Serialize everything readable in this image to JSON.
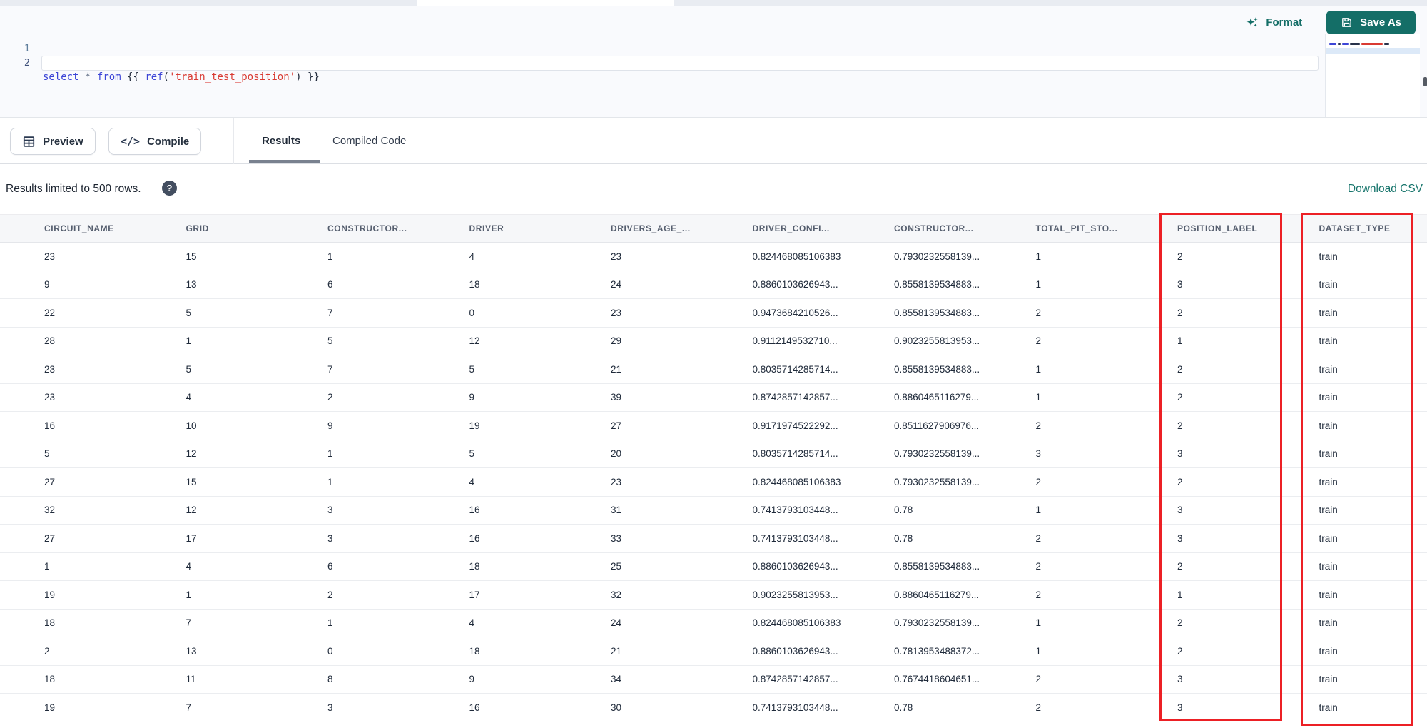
{
  "editor": {
    "line_numbers": [
      "1",
      "2"
    ],
    "code_line": {
      "tokens": [
        {
          "text": "select",
          "color": "#3c45d6"
        },
        {
          "text": " ",
          "color": "#222b3c"
        },
        {
          "text": "*",
          "color": "#5a6880"
        },
        {
          "text": " ",
          "color": "#222b3c"
        },
        {
          "text": "from",
          "color": "#3c45d6"
        },
        {
          "text": " {{ ",
          "color": "#222b3c"
        },
        {
          "text": "ref",
          "color": "#3c45d6"
        },
        {
          "text": "(",
          "color": "#222b3c"
        },
        {
          "text": "'train_test_position'",
          "color": "#d93a32"
        },
        {
          "text": ")",
          "color": "#222b3c"
        },
        {
          "text": " }}",
          "color": "#222b3c"
        }
      ]
    },
    "format_label": "Format",
    "save_as_label": "Save As"
  },
  "toolbar": {
    "preview_label": "Preview",
    "compile_label": "Compile",
    "tabs": [
      {
        "label": "Results",
        "active": true
      },
      {
        "label": "Compiled Code",
        "active": false
      }
    ]
  },
  "icons": {
    "compile_glyph": "</>",
    "help_glyph": "?"
  },
  "results_bar": {
    "limit_text": "Results limited to 500 rows.",
    "download_label": "Download CSV"
  },
  "table": {
    "columns": [
      "CIRCUIT_NAME",
      "GRID",
      "CONSTRUCTOR...",
      "DRIVER",
      "DRIVERS_AGE_...",
      "DRIVER_CONFI...",
      "CONSTRUCTOR...",
      "TOTAL_PIT_STO...",
      "POSITION_LABEL",
      "DATASET_TYPE"
    ],
    "rows": [
      [
        "23",
        "15",
        "1",
        "4",
        "23",
        "0.824468085106383",
        "0.7930232558139...",
        "1",
        "2",
        "train"
      ],
      [
        "9",
        "13",
        "6",
        "18",
        "24",
        "0.8860103626943...",
        "0.8558139534883...",
        "1",
        "3",
        "train"
      ],
      [
        "22",
        "5",
        "7",
        "0",
        "23",
        "0.9473684210526...",
        "0.8558139534883...",
        "2",
        "2",
        "train"
      ],
      [
        "28",
        "1",
        "5",
        "12",
        "29",
        "0.9112149532710...",
        "0.9023255813953...",
        "2",
        "1",
        "train"
      ],
      [
        "23",
        "5",
        "7",
        "5",
        "21",
        "0.8035714285714...",
        "0.8558139534883...",
        "1",
        "2",
        "train"
      ],
      [
        "23",
        "4",
        "2",
        "9",
        "39",
        "0.8742857142857...",
        "0.8860465116279...",
        "1",
        "2",
        "train"
      ],
      [
        "16",
        "10",
        "9",
        "19",
        "27",
        "0.9171974522292...",
        "0.8511627906976...",
        "2",
        "2",
        "train"
      ],
      [
        "5",
        "12",
        "1",
        "5",
        "20",
        "0.8035714285714...",
        "0.7930232558139...",
        "3",
        "3",
        "train"
      ],
      [
        "27",
        "15",
        "1",
        "4",
        "23",
        "0.824468085106383",
        "0.7930232558139...",
        "2",
        "2",
        "train"
      ],
      [
        "32",
        "12",
        "3",
        "16",
        "31",
        "0.7413793103448...",
        "0.78",
        "1",
        "3",
        "train"
      ],
      [
        "27",
        "17",
        "3",
        "16",
        "33",
        "0.7413793103448...",
        "0.78",
        "2",
        "3",
        "train"
      ],
      [
        "1",
        "4",
        "6",
        "18",
        "25",
        "0.8860103626943...",
        "0.8558139534883...",
        "2",
        "2",
        "train"
      ],
      [
        "19",
        "1",
        "2",
        "17",
        "32",
        "0.9023255813953...",
        "0.8860465116279...",
        "2",
        "1",
        "train"
      ],
      [
        "18",
        "7",
        "1",
        "4",
        "24",
        "0.824468085106383",
        "0.7930232558139...",
        "1",
        "2",
        "train"
      ],
      [
        "2",
        "13",
        "0",
        "18",
        "21",
        "0.8860103626943...",
        "0.7813953488372...",
        "1",
        "2",
        "train"
      ],
      [
        "18",
        "11",
        "8",
        "9",
        "34",
        "0.8742857142857...",
        "0.7674418604651...",
        "2",
        "3",
        "train"
      ],
      [
        "19",
        "7",
        "3",
        "16",
        "30",
        "0.7413793103448...",
        "0.78",
        "2",
        "3",
        "train"
      ]
    ]
  },
  "annotations": {
    "highlight_color": "#ec2025",
    "highlighted_columns": [
      "POSITION_LABEL",
      "DATASET_TYPE"
    ]
  },
  "colors": {
    "accent_teal": "#146e67",
    "editor_background": "#f9fafd",
    "keyword_blue": "#3c45d6",
    "string_red": "#d93a32"
  }
}
